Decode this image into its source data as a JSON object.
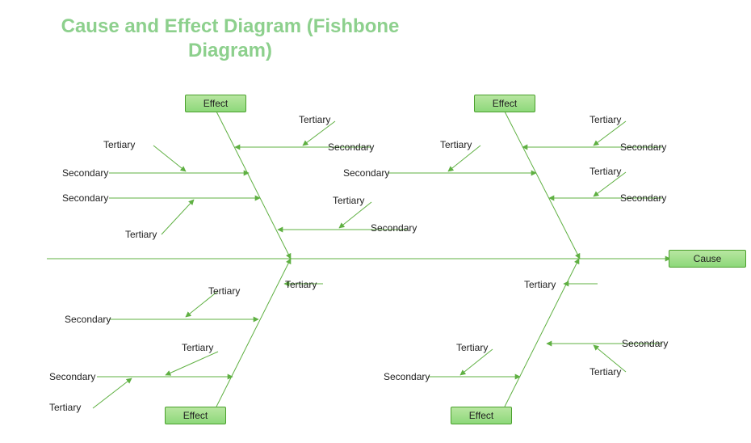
{
  "title": "Cause and Effect Diagram (Fishbone Diagram)",
  "cause_label": "Cause",
  "effect_label": "Effect",
  "secondary_label": "Secondary",
  "tertiary_label": "Tertiary",
  "colors": {
    "title": "#8dd08d",
    "line": "#5fb042",
    "box_fill_top": "#b8e6a1",
    "box_fill_bottom": "#8dd87a",
    "box_border": "#4aa02c"
  }
}
